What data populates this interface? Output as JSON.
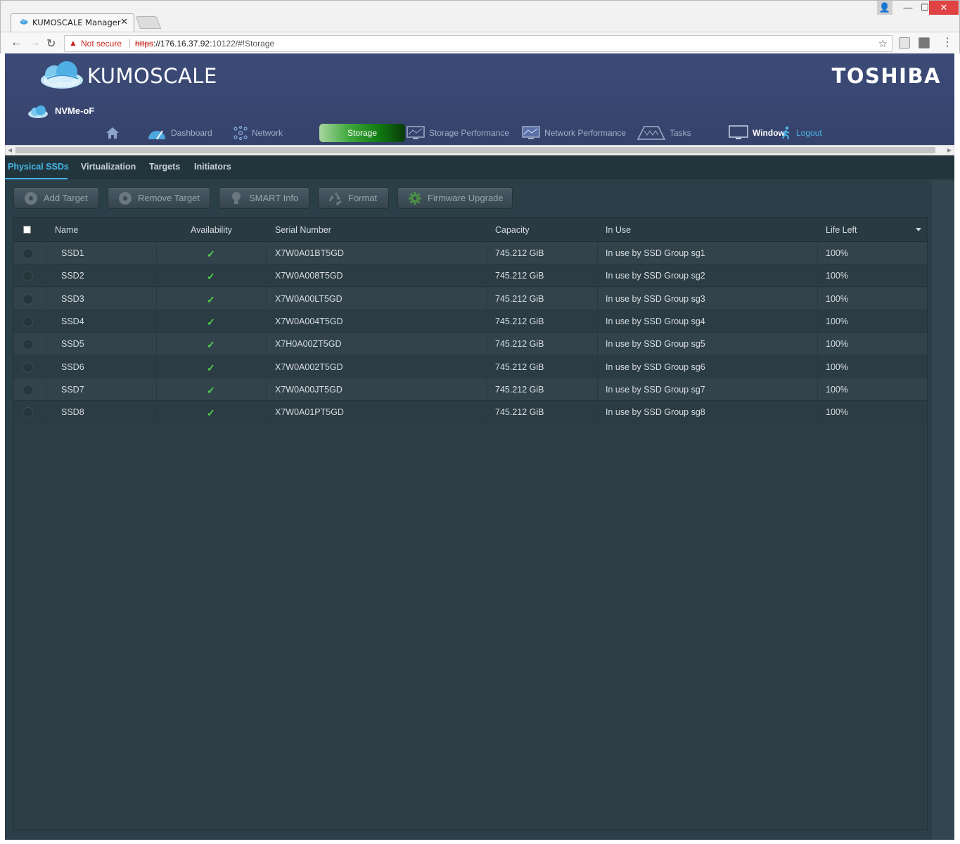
{
  "browser": {
    "tab_title": "KUMOSCALE Manager",
    "security_label": "Not secure",
    "url_scheme": "https",
    "url_host": "://176.16.37.92",
    "url_rest": ":10122/#!Storage"
  },
  "header": {
    "logo_text": "KUMOSCALE",
    "brand": "TOSHIBA",
    "product": "NVMe-oF"
  },
  "nav": {
    "dashboard": "Dashboard",
    "network": "Network",
    "storage": "Storage",
    "storage_performance": "Storage Performance",
    "network_performance": "Network Performance",
    "tasks": "Tasks",
    "window": "Window",
    "logout": "Logout"
  },
  "subtabs": {
    "physical_ssds": "Physical SSDs",
    "virtualization": "Virtualization",
    "targets": "Targets",
    "initiators": "Initiators"
  },
  "actions": {
    "add_target": "Add Target",
    "remove_target": "Remove Target",
    "smart_info": "SMART Info",
    "format": "Format",
    "firmware_upgrade": "Firmware Upgrade"
  },
  "table": {
    "columns": {
      "name": "Name",
      "availability": "Availability",
      "serial": "Serial Number",
      "capacity": "Capacity",
      "in_use": "In Use",
      "life_left": "Life Left"
    },
    "check_glyph": "✓",
    "rows": [
      {
        "name": "SSD1",
        "serial": "X7W0A01BT5GD",
        "capacity": "745.212 GiB",
        "in_use": "In use by SSD Group sg1",
        "life_left": "100%"
      },
      {
        "name": "SSD2",
        "serial": "X7W0A008T5GD",
        "capacity": "745.212 GiB",
        "in_use": "In use by SSD Group sg2",
        "life_left": "100%"
      },
      {
        "name": "SSD3",
        "serial": "X7W0A00LT5GD",
        "capacity": "745.212 GiB",
        "in_use": "In use by SSD Group sg3",
        "life_left": "100%"
      },
      {
        "name": "SSD4",
        "serial": "X7W0A004T5GD",
        "capacity": "745.212 GiB",
        "in_use": "In use by SSD Group sg4",
        "life_left": "100%"
      },
      {
        "name": "SSD5",
        "serial": "X7H0A00ZT5GD",
        "capacity": "745.212 GiB",
        "in_use": "In use by SSD Group sg5",
        "life_left": "100%"
      },
      {
        "name": "SSD6",
        "serial": "X7W0A002T5GD",
        "capacity": "745.212 GiB",
        "in_use": "In use by SSD Group sg6",
        "life_left": "100%"
      },
      {
        "name": "SSD7",
        "serial": "X7W0A00JT5GD",
        "capacity": "745.212 GiB",
        "in_use": "In use by SSD Group sg7",
        "life_left": "100%"
      },
      {
        "name": "SSD8",
        "serial": "X7W0A01PT5GD",
        "capacity": "745.212 GiB",
        "in_use": "In use by SSD Group sg8",
        "life_left": "100%"
      }
    ]
  },
  "colors": {
    "accent": "#45b6e6",
    "header_bg": "#3d4b78",
    "panel_bg": "#2b3f48",
    "storage_active": "#3ea83c",
    "check": "#4fd14a"
  }
}
